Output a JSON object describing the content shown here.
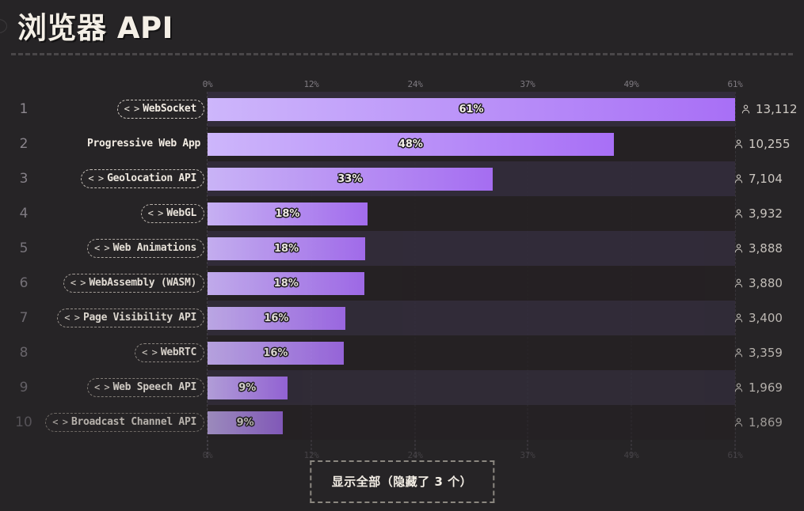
{
  "header": {
    "title": "浏览器 API",
    "decoration_icon": "circle-outline-icon",
    "divider_icon": "dashed-divider"
  },
  "footer": {
    "show_all_label": "显示全部（隐藏了 3 个）",
    "hidden_count": 3
  },
  "icons": {
    "code": "< >",
    "person": "person-icon"
  },
  "colors": {
    "background": "#262426",
    "bar_gradient_start": "#cdb6fb",
    "bar_gradient_end": "#a86ff6",
    "title_text": "#f4efe6",
    "row_stripe_odd": "#322c3a",
    "row_stripe_even": "#252123",
    "axis_label": "#7e7a80",
    "axis_label_bottom": "#454246",
    "value_text": "#cfcac4",
    "pill_border": "#b9b3ad"
  },
  "chart_data": {
    "type": "bar",
    "title": "浏览器 API",
    "orientation": "horizontal",
    "xlabel": "",
    "ylabel": "",
    "xlim": [
      0,
      61
    ],
    "grid": true,
    "legend": "none",
    "axis_ticks": [
      "0%",
      "12%",
      "24%",
      "37%",
      "49%",
      "61%"
    ],
    "axis_tick_values": [
      0,
      12,
      24,
      37,
      49,
      61
    ],
    "axis_position": "both",
    "categories": [
      "WebSocket",
      "Progressive Web App",
      "Geolocation API",
      "WebGL",
      "Web Animations",
      "WebAssembly (WASM)",
      "Page Visibility API",
      "WebRTC",
      "Web Speech API",
      "Broadcast Channel API"
    ],
    "values": [
      61,
      48,
      33,
      18,
      18,
      18,
      16,
      16,
      9,
      9
    ],
    "value_labels": [
      "61%",
      "48%",
      "33%",
      "18%",
      "18%",
      "18%",
      "16%",
      "16%",
      "9%",
      "9%"
    ],
    "counts": [
      13112,
      10255,
      7104,
      3932,
      3888,
      3880,
      3400,
      3359,
      1969,
      1869
    ],
    "count_labels": [
      "13,112",
      "10,255",
      "7,104",
      "3,932",
      "3,888",
      "3,880",
      "3,400",
      "3,359",
      "1,969",
      "1,869"
    ]
  },
  "rows": [
    {
      "rank": "1",
      "label": "WebSocket",
      "pill": true,
      "value_label": "61%",
      "pct": 61,
      "bar_pct": 100.0,
      "count_label": "13,112",
      "opacity": 1.0,
      "rank_color": "#8d888f",
      "pill_border": "#cfc9c2"
    },
    {
      "rank": "2",
      "label": "Progressive Web App",
      "pill": false,
      "value_label": "48%",
      "pct": 48,
      "bar_pct": 77.0,
      "count_label": "10,255",
      "opacity": 1.0,
      "rank_color": "#8a858c",
      "pill_border": "transparent"
    },
    {
      "rank": "3",
      "label": "Geolocation API",
      "pill": true,
      "value_label": "33%",
      "pct": 33,
      "bar_pct": 54.0,
      "count_label": "7,104",
      "opacity": 0.98,
      "rank_color": "#878289",
      "pill_border": "#c5bfb8"
    },
    {
      "rank": "4",
      "label": "WebGL",
      "pill": true,
      "value_label": "18%",
      "pct": 18,
      "bar_pct": 30.3,
      "count_label": "3,932",
      "opacity": 0.96,
      "rank_color": "#837f86",
      "pill_border": "#bcb6af"
    },
    {
      "rank": "5",
      "label": "Web Animations",
      "pill": true,
      "value_label": "18%",
      "pct": 18,
      "bar_pct": 29.9,
      "count_label": "3,888",
      "opacity": 0.94,
      "rank_color": "#7f7b82",
      "pill_border": "#b4aea7"
    },
    {
      "rank": "6",
      "label": "WebAssembly (WASM)",
      "pill": true,
      "value_label": "18%",
      "pct": 18,
      "bar_pct": 29.8,
      "count_label": "3,880",
      "opacity": 0.92,
      "rank_color": "#7b777e",
      "pill_border": "#aca69f"
    },
    {
      "rank": "7",
      "label": "Page Visibility API",
      "pill": true,
      "value_label": "16%",
      "pct": 16,
      "bar_pct": 26.1,
      "count_label": "3,400",
      "opacity": 0.89,
      "rank_color": "#77737a",
      "pill_border": "#a49e97"
    },
    {
      "rank": "8",
      "label": "WebRTC",
      "pill": true,
      "value_label": "16%",
      "pct": 16,
      "bar_pct": 25.8,
      "count_label": "3,359",
      "opacity": 0.86,
      "rank_color": "#736f76",
      "pill_border": "#9c968f"
    },
    {
      "rank": "9",
      "label": "Web Speech API",
      "pill": true,
      "value_label": "9%",
      "pct": 9,
      "bar_pct": 15.1,
      "count_label": "1,969",
      "opacity": 0.83,
      "rank_color": "#6f6b72",
      "pill_border": "#948e87"
    },
    {
      "rank": "10",
      "label": "Broadcast Channel API",
      "pill": true,
      "value_label": "9%",
      "pct": 9,
      "bar_pct": 14.3,
      "count_label": "1,869",
      "opacity": 0.7,
      "rank_color": "#6a666d",
      "pill_border": "#8c867f"
    }
  ]
}
